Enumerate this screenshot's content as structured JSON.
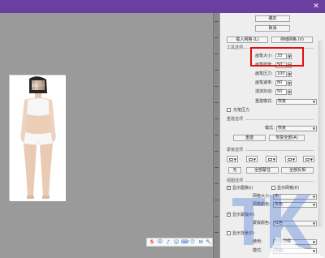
{
  "panel": {
    "ok_label": "确定",
    "cancel_label": "取消",
    "load_mesh_label": "载入网格 (L)",
    "save_mesh_label": "存储网格 (V)",
    "tool_options_label": "工具选项",
    "brush_size_label": "画笔大小:",
    "brush_size_value": "33",
    "brush_density_label": "画笔密度:",
    "brush_density_value": "50",
    "brush_pressure_label": "画笔压力:",
    "brush_pressure_value": "100",
    "brush_rate_label": "画笔速率:",
    "brush_rate_value": "80",
    "turbulent_jitter_label": "湍流抖动:",
    "turbulent_jitter_value": "50",
    "rebuild_mode_label": "重建模式:",
    "rebuild_mode_value": "恢复",
    "stylus_pressure_label": "光笔压力",
    "rebuild_options_label": "重建选项",
    "mode_label": "模式:",
    "mode_value": "恢复",
    "rebuild_button": "重建",
    "restore_all_button": "恢复全部(A)",
    "mask_options_label": "蒙板选项",
    "none_button": "无",
    "mask_all_button": "全部蒙住",
    "invert_all_button": "全部反相",
    "view_options_label": "视图选项",
    "show_image_label": "显示图像(I)",
    "show_mesh_label": "显示网格(E)",
    "mesh_size_label": "网格大小:",
    "mesh_size_value": "中",
    "mesh_color_label": "网格颜色:",
    "mesh_color_value": "灰色",
    "show_mask_label": "显示蒙版(K)",
    "mask_color_label": "蒙版颜色:",
    "mask_color_value": "红色",
    "show_background_label": "显示背景(P)",
    "use_label": "使用:",
    "use_value": "所有图层",
    "backdrop_mode_label": "模式:",
    "backdrop_mode_value": "前面"
  },
  "ime": {
    "items": [
      "S",
      "中",
      "♪",
      "☺",
      "⌨",
      "👕",
      "✉",
      "🔧"
    ]
  },
  "colors": {
    "titlebar": "#6b3fa0",
    "canvas": "#9a9a9a",
    "panel": "#eeeeee",
    "highlight": "#e01010",
    "watermark": "#3a6fd6"
  }
}
